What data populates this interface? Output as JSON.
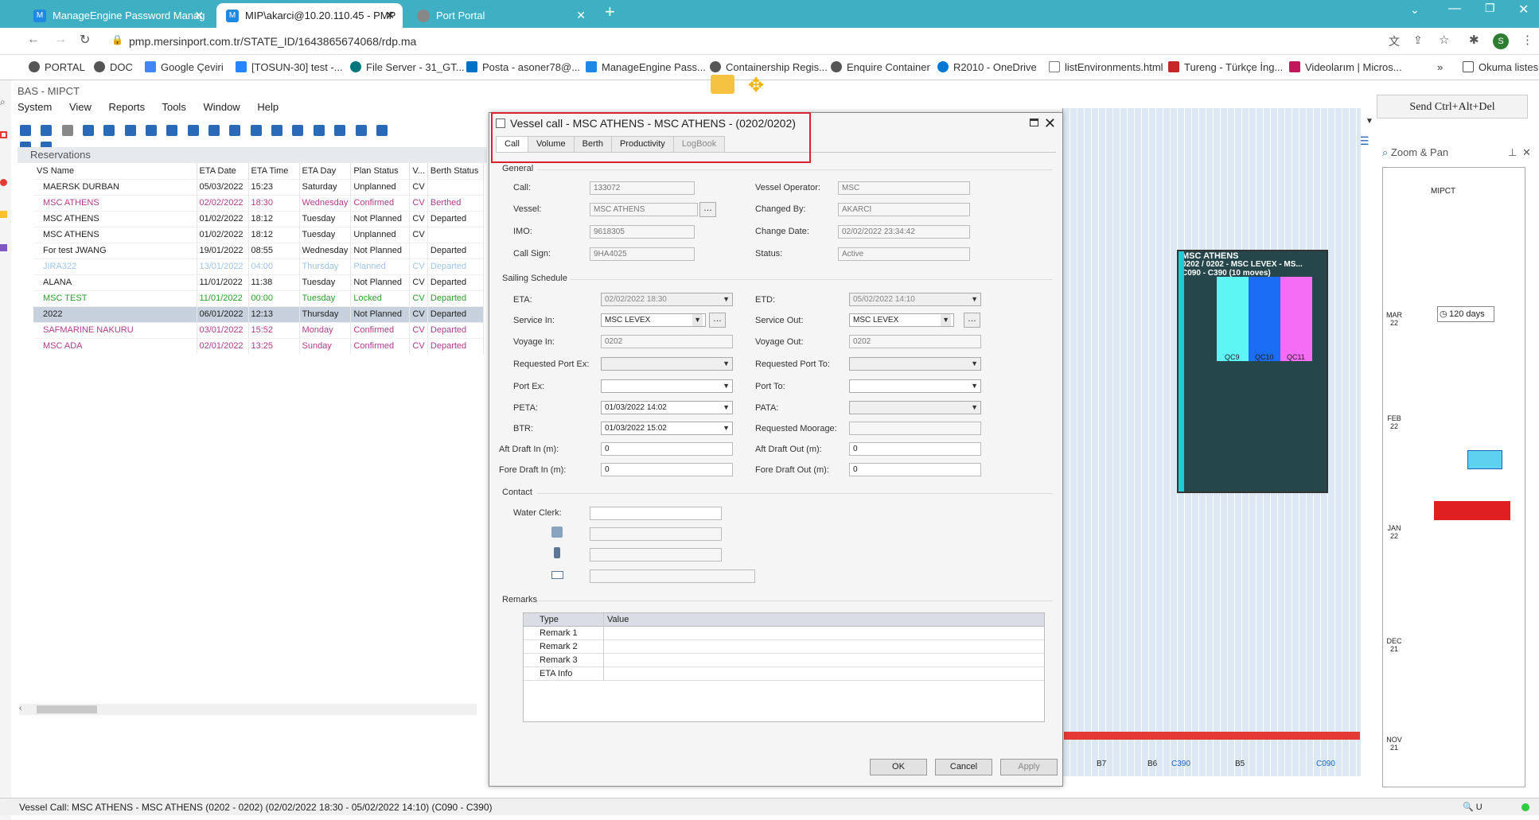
{
  "browser": {
    "tabs": [
      {
        "label": "ManageEngine Password Manag"
      },
      {
        "label": "MIP\\akarci@10.20.110.45 - PMP"
      },
      {
        "label": "Port Portal"
      }
    ],
    "url": "pmp.mersinport.com.tr/STATE_ID/1643865674068/rdp.ma",
    "bookmarks": [
      "PORTAL",
      "DOC",
      "Google Çeviri",
      "[TOSUN-30] test -...",
      "File Server - 31_GT...",
      "Posta - asoner78@...",
      "ManageEngine Pass...",
      "Containership Regis...",
      "Enquire Container",
      "R2010 - OneDrive",
      "listEnvironments.html",
      "Tureng - Türkçe İng...",
      "Videolarım | Micros..."
    ],
    "reading_list": "Okuma listesi",
    "profile_initial": "S"
  },
  "app": {
    "title": "BAS - MIPCT",
    "menu": [
      "System",
      "View",
      "Reports",
      "Tools",
      "Window",
      "Help"
    ],
    "send_cad": "Send Ctrl+Alt+Del"
  },
  "reservations": {
    "title": "Reservations",
    "columns": [
      "VS Name",
      "ETA Date",
      "ETA Time",
      "ETA Day",
      "Plan Status",
      "V...",
      "Berth Status"
    ],
    "rows": [
      {
        "name": "MAERSK DURBAN",
        "date": "05/03/2022",
        "time": "15:23",
        "day": "Saturday",
        "plan": "Unplanned",
        "v": "CV",
        "berth": "",
        "style": ""
      },
      {
        "name": "MSC ATHENS",
        "date": "02/02/2022",
        "time": "18:30",
        "day": "Wednesday",
        "plan": "Confirmed",
        "v": "CV",
        "berth": "Berthed",
        "style": "pink"
      },
      {
        "name": "MSC ATHENS",
        "date": "01/02/2022",
        "time": "18:12",
        "day": "Tuesday",
        "plan": "Not Planned",
        "v": "CV",
        "berth": "Departed",
        "style": ""
      },
      {
        "name": "MSC ATHENS",
        "date": "01/02/2022",
        "time": "18:12",
        "day": "Tuesday",
        "plan": "Unplanned",
        "v": "CV",
        "berth": "",
        "style": ""
      },
      {
        "name": "For test JWANG",
        "date": "19/01/2022",
        "time": "08:55",
        "day": "Wednesday",
        "plan": "Not Planned",
        "v": "",
        "berth": "Departed",
        "style": ""
      },
      {
        "name": "JIRA322",
        "date": "13/01/2022",
        "time": "04:00",
        "day": "Thursday",
        "plan": "Planned",
        "v": "CV",
        "berth": "Departed",
        "style": "faded"
      },
      {
        "name": "ALANA",
        "date": "11/01/2022",
        "time": "11:38",
        "day": "Tuesday",
        "plan": "Not Planned",
        "v": "CV",
        "berth": "Departed",
        "style": ""
      },
      {
        "name": "MSC TEST",
        "date": "11/01/2022",
        "time": "00:00",
        "day": "Tuesday",
        "plan": "Locked",
        "v": "CV",
        "berth": "Departed",
        "style": "green"
      },
      {
        "name": "2022",
        "date": "06/01/2022",
        "time": "12:13",
        "day": "Thursday",
        "plan": "Not Planned",
        "v": "CV",
        "berth": "Departed",
        "style": "selected"
      },
      {
        "name": "SAFMARINE NAKURU",
        "date": "03/01/2022",
        "time": "15:52",
        "day": "Monday",
        "plan": "Confirmed",
        "v": "CV",
        "berth": "Departed",
        "style": "pink"
      },
      {
        "name": "MSC ADA",
        "date": "02/01/2022",
        "time": "13:25",
        "day": "Sunday",
        "plan": "Confirmed",
        "v": "CV",
        "berth": "Departed",
        "style": "pink"
      }
    ]
  },
  "gantt": {
    "vessel_title": "MSC ATHENS",
    "vessel_sub": "0202 / 0202 - MSC LEVEX - MS...",
    "vessel_moves": "C090 - C390 (10 moves)",
    "cranes": [
      "QC9",
      "QC10",
      "QC11"
    ]
  },
  "zoom": {
    "title": "Zoom & Pan",
    "terminal": "MIPCT",
    "days": "120 days",
    "months": [
      "MAR 22",
      "FEB 22",
      "JAN 22",
      "DEC 21",
      "NOV 21"
    ]
  },
  "dialog": {
    "title": "Vessel call  - MSC ATHENS - MSC ATHENS - (0202/0202)",
    "tabs": [
      "Call",
      "Volume",
      "Berth",
      "Productivity",
      "LogBook"
    ],
    "general": {
      "header": "General",
      "call_label": "Call:",
      "call": "133072",
      "vessel_label": "Vessel:",
      "vessel": "MSC ATHENS",
      "imo_label": "IMO:",
      "imo": "9618305",
      "callsign_label": "Call Sign:",
      "callsign": "9HA4025",
      "operator_label": "Vessel Operator:",
      "operator": "MSC",
      "changedby_label": "Changed By:",
      "changedby": "AKARCI",
      "changedate_label": "Change Date:",
      "changedate": "02/02/2022 23:34:42",
      "status_label": "Status:",
      "status": "Active"
    },
    "sailing": {
      "header": "Sailing Schedule",
      "eta_label": "ETA:",
      "eta": "02/02/2022 18:30",
      "etd_label": "ETD:",
      "etd": "05/02/2022 14:10",
      "servicein_label": "Service In:",
      "servicein": "MSC LEVEX",
      "serviceout_label": "Service Out:",
      "serviceout": "MSC LEVEX",
      "voyagein_label": "Voyage In:",
      "voyagein": "0202",
      "voyageout_label": "Voyage Out:",
      "voyageout": "0202",
      "reqportex_label": "Requested Port Ex:",
      "reqportto_label": "Requested Port To:",
      "portex_label": "Port Ex:",
      "portto_label": "Port To:",
      "peta_label": "PETA:",
      "peta": "01/03/2022 14:02",
      "pata_label": "PATA:",
      "btr_label": "BTR:",
      "btr": "01/03/2022 15:02",
      "reqmoor_label": "Requested Moorage:",
      "aftin_label": "Aft Draft In (m):",
      "aftin": "0",
      "aftout_label": "Aft Draft Out (m):",
      "aftout": "0",
      "forein_label": "Fore Draft In (m):",
      "forein": "0",
      "foreout_label": "Fore Draft Out (m):",
      "foreout": "0"
    },
    "contact": {
      "header": "Contact",
      "clerk_label": "Water Clerk:"
    },
    "remarks": {
      "header": "Remarks",
      "col_type": "Type",
      "col_value": "Value",
      "rows": [
        "Remark 1",
        "Remark 2",
        "Remark 3",
        "ETA Info"
      ]
    },
    "buttons": {
      "ok": "OK",
      "cancel": "Cancel",
      "apply": "Apply"
    }
  },
  "statusbar": "Vessel Call: MSC ATHENS - MSC ATHENS (0202 - 0202) (02/02/2022 18:30 - 05/02/2022 14:10) (C090 - C390)"
}
